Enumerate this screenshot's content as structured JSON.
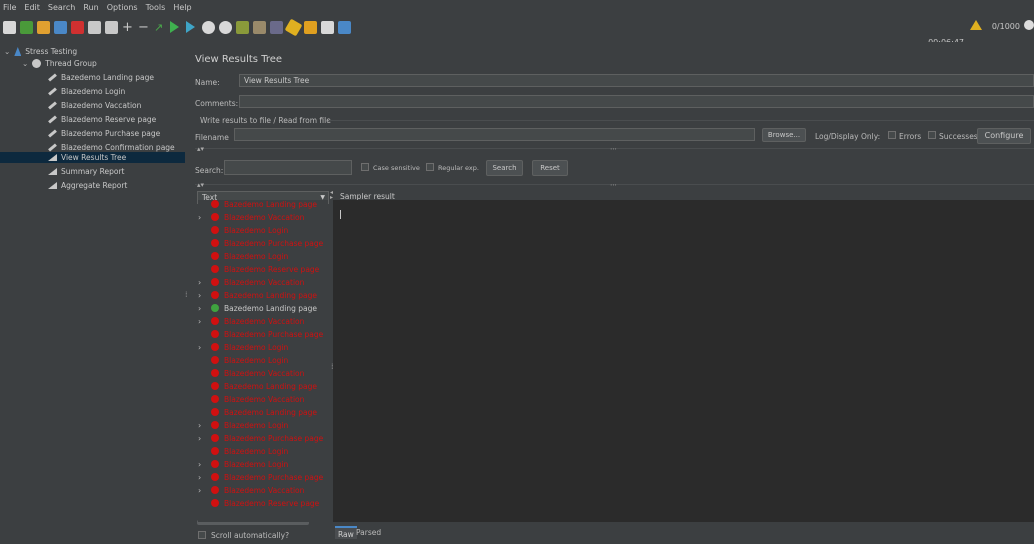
{
  "menu": [
    "File",
    "Edit",
    "Search",
    "Run",
    "Options",
    "Tools",
    "Help"
  ],
  "toolbar": {
    "timer": "00:06:47",
    "threads": "0/1000"
  },
  "tree": [
    {
      "label": "Stress Testing",
      "level": 0,
      "icon": "flask-icon",
      "expanded": true
    },
    {
      "label": "Thread Group",
      "level": 1,
      "icon": "gear-icon",
      "expanded": true
    },
    {
      "label": "Bazedemo Landing page",
      "level": 2,
      "icon": "sampler-icon"
    },
    {
      "label": "Blazedemo Login",
      "level": 2,
      "icon": "sampler-icon"
    },
    {
      "label": "Blazedemo Vaccation",
      "level": 2,
      "icon": "sampler-icon"
    },
    {
      "label": "Blazedemo Reserve page",
      "level": 2,
      "icon": "sampler-icon"
    },
    {
      "label": "Blazedemo Purchase page",
      "level": 2,
      "icon": "sampler-icon"
    },
    {
      "label": "Blazedemo Confirmation page",
      "level": 2,
      "icon": "sampler-icon"
    },
    {
      "label": "View Results Tree",
      "level": 2,
      "icon": "chart-icon",
      "selected": true
    },
    {
      "label": "Summary Report",
      "level": 2,
      "icon": "chart-icon"
    },
    {
      "label": "Aggregate Report",
      "level": 2,
      "icon": "chart-icon"
    }
  ],
  "panel": {
    "title": "View Results Tree",
    "name_label": "Name:",
    "name_value": "View Results Tree",
    "comments_label": "Comments:",
    "write_results_label": "Write results to file / Read from file",
    "filename_label": "Filename",
    "browse_label": "Browse...",
    "log_display_label": "Log/Display Only:",
    "errors_label": "Errors",
    "successes_label": "Successes",
    "configure_label": "Configure",
    "search_label": "Search:",
    "case_sensitive_label": "Case sensitive",
    "regular_exp_label": "Regular exp.",
    "search_button": "Search",
    "reset_button": "Reset",
    "renderer_select": "Text",
    "sampler_tab": "Sampler result",
    "scroll_auto_label": "Scroll automatically?",
    "raw_tab": "Raw",
    "parsed_tab": "Parsed"
  },
  "results": [
    {
      "label": "Bazedemo Landing page",
      "ok": false,
      "arrow": false
    },
    {
      "label": "Blazedemo Vaccation",
      "ok": false,
      "arrow": true
    },
    {
      "label": "Blazedemo Login",
      "ok": false,
      "arrow": false
    },
    {
      "label": "Blazedemo Purchase page",
      "ok": false,
      "arrow": false
    },
    {
      "label": "Blazedemo Login",
      "ok": false,
      "arrow": false
    },
    {
      "label": "Blazedemo Reserve page",
      "ok": false,
      "arrow": false
    },
    {
      "label": "Blazedemo Vaccation",
      "ok": false,
      "arrow": true
    },
    {
      "label": "Bazedemo Landing page",
      "ok": false,
      "arrow": true
    },
    {
      "label": "Bazedemo Landing page",
      "ok": true,
      "arrow": true
    },
    {
      "label": "Blazedemo Vaccation",
      "ok": false,
      "arrow": true
    },
    {
      "label": "Blazedemo Purchase page",
      "ok": false,
      "arrow": false
    },
    {
      "label": "Blazedemo Login",
      "ok": false,
      "arrow": true
    },
    {
      "label": "Blazedemo Login",
      "ok": false,
      "arrow": false
    },
    {
      "label": "Blazedemo Vaccation",
      "ok": false,
      "arrow": false
    },
    {
      "label": "Bazedemo Landing page",
      "ok": false,
      "arrow": false
    },
    {
      "label": "Blazedemo Vaccation",
      "ok": false,
      "arrow": false
    },
    {
      "label": "Bazedemo Landing page",
      "ok": false,
      "arrow": false
    },
    {
      "label": "Blazedemo Login",
      "ok": false,
      "arrow": true
    },
    {
      "label": "Blazedemo Purchase page",
      "ok": false,
      "arrow": true
    },
    {
      "label": "Blazedemo Login",
      "ok": false,
      "arrow": false
    },
    {
      "label": "Blazedemo Login",
      "ok": false,
      "arrow": true
    },
    {
      "label": "Blazedemo Purchase page",
      "ok": false,
      "arrow": true
    },
    {
      "label": "Blazedemo Vaccation",
      "ok": false,
      "arrow": true
    },
    {
      "label": "Blazedemo Reserve page",
      "ok": false,
      "arrow": false
    }
  ],
  "colors": {
    "error": "#d01010",
    "ok": "#3fa33f",
    "selected": "#0d293e",
    "accent": "#4a88c7"
  }
}
